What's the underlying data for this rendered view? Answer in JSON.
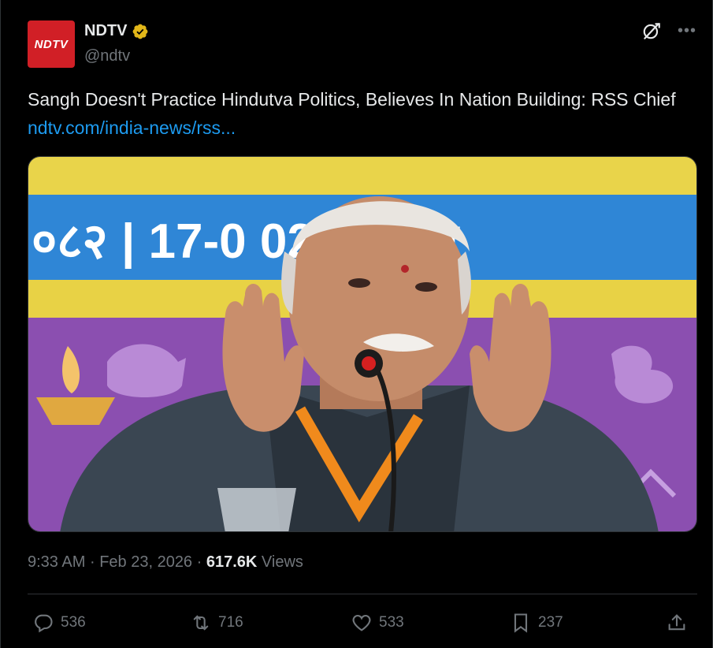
{
  "account": {
    "logo_text": "NDTV",
    "name": "NDTV",
    "handle": "@ndtv",
    "verified": "gold-verified-badge"
  },
  "post": {
    "text": "Sangh Doesn't Practice Hindutva Politics, Believes In Nation Building: RSS Chief ",
    "link_text": "ndtv.com/india-news/rss..."
  },
  "photo": {
    "banner_text": "०८२ | 17-0      026, मंगल"
  },
  "meta": {
    "time": "9:33 AM",
    "separator": "·",
    "date": "Feb 23, 2026",
    "views_count": "617.6K",
    "views_label": "Views"
  },
  "actions": {
    "replies": "536",
    "reposts": "716",
    "likes": "533",
    "bookmarks": "237"
  },
  "colors": {
    "background": "#000000",
    "text": "#e7e9ea",
    "muted": "#71767b",
    "link": "#1d9bf0",
    "brand": "#d11f26"
  }
}
